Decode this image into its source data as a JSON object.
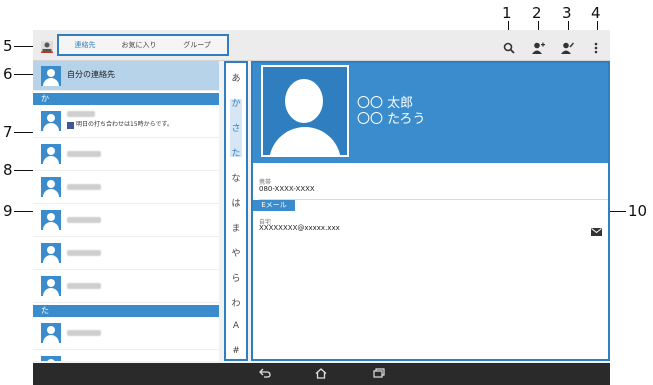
{
  "callouts": [
    "1",
    "2",
    "3",
    "4",
    "5",
    "6",
    "7",
    "8",
    "9",
    "10"
  ],
  "tabs": {
    "contacts": "連絡先",
    "favorites": "お気に入り",
    "groups": "グループ"
  },
  "profile_row": {
    "label": "自分の連絡先"
  },
  "sections": {
    "ka": "か",
    "ta": "た"
  },
  "contacts": [
    {
      "status": "明日の打ち合わせは15時からです。"
    }
  ],
  "index_letters": [
    "あ",
    "か",
    "さ",
    "た",
    "な",
    "は",
    "ま",
    "や",
    "ら",
    "わ",
    "A",
    "#"
  ],
  "detail": {
    "name_line1": "〇〇 太郎",
    "name_line2": "〇〇 たろう",
    "phone_label": "携帯",
    "phone_value": "080-XXXX-XXXX",
    "email_section": "Eメール",
    "email_label": "自宅",
    "email_value": "XXXXXXXX@xxxxx.xxx"
  },
  "icons": {
    "search": "search-icon",
    "add_contact": "add-contact-icon",
    "edit_contact": "edit-contact-icon",
    "menu": "overflow-menu-icon",
    "mail": "mail-icon",
    "facebook": "facebook-icon",
    "back": "back-icon",
    "home": "home-icon",
    "recents": "recent-apps-icon"
  },
  "colors": {
    "accent": "#3a8ccc",
    "outline": "#2f7fc0"
  }
}
